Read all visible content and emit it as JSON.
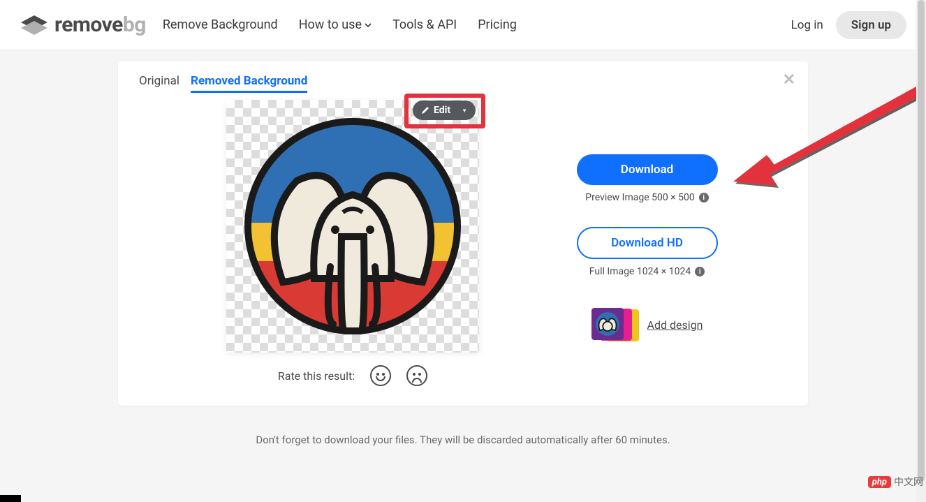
{
  "header": {
    "logo_prefix": "remove",
    "logo_suffix": "bg",
    "nav": {
      "remove_bg": "Remove Background",
      "how_to_use": "How to use",
      "tools_api": "Tools & API",
      "pricing": "Pricing"
    },
    "auth": {
      "login": "Log in",
      "signup": "Sign up"
    }
  },
  "tabs": {
    "original": "Original",
    "removed": "Removed Background"
  },
  "edit_button": "Edit",
  "rate": {
    "label": "Rate this result:"
  },
  "actions": {
    "download": "Download",
    "preview_caption": "Preview Image 500 × 500",
    "download_hd": "Download HD",
    "full_caption": "Full Image 1024 × 1024",
    "add_design": "Add design"
  },
  "footer_note": "Don't forget to download your files. They will be discarded automatically after 60 minutes.",
  "watermark": {
    "badge": "php",
    "text": "中文网"
  }
}
